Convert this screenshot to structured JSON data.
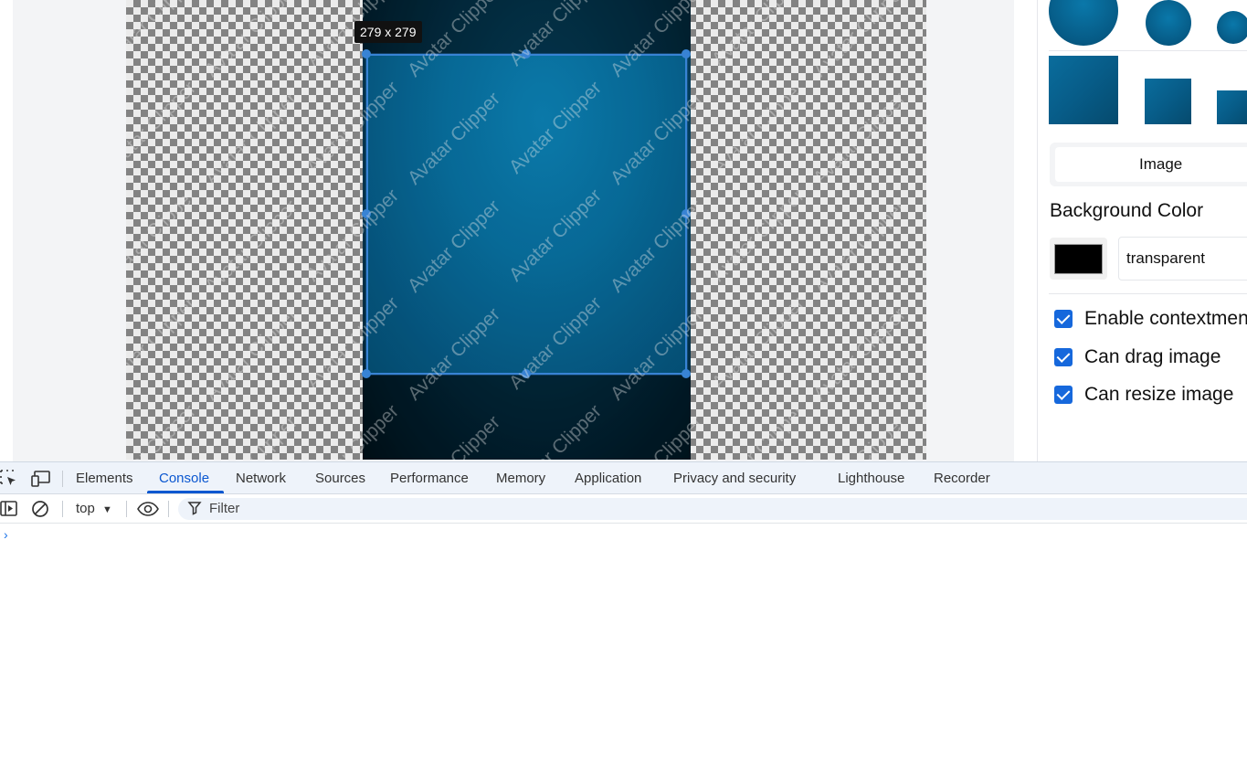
{
  "editor": {
    "crop_size_label": "279 x 279",
    "watermark_text": "Avatar Clipper"
  },
  "panel": {
    "image_button_label": "Image",
    "background_color_title": "Background Color",
    "background_color_swatch": "#000000",
    "background_color_value": "transparent",
    "options": [
      {
        "label": "Enable contextmen",
        "checked": true
      },
      {
        "label": "Can drag image",
        "checked": true
      },
      {
        "label": "Can resize image",
        "checked": true
      }
    ]
  },
  "devtools": {
    "tabs": [
      "Elements",
      "Console",
      "Network",
      "Sources",
      "Performance",
      "Memory",
      "Application",
      "Privacy and security",
      "Lighthouse",
      "Recorder"
    ],
    "active_tab": "Console",
    "context": "top",
    "filter_placeholder": "Filter",
    "prompt_symbol": "›"
  },
  "colors": {
    "accent": "#0b57d0",
    "crop_border": "#3d8fe6",
    "checkbox": "#1668dc"
  }
}
